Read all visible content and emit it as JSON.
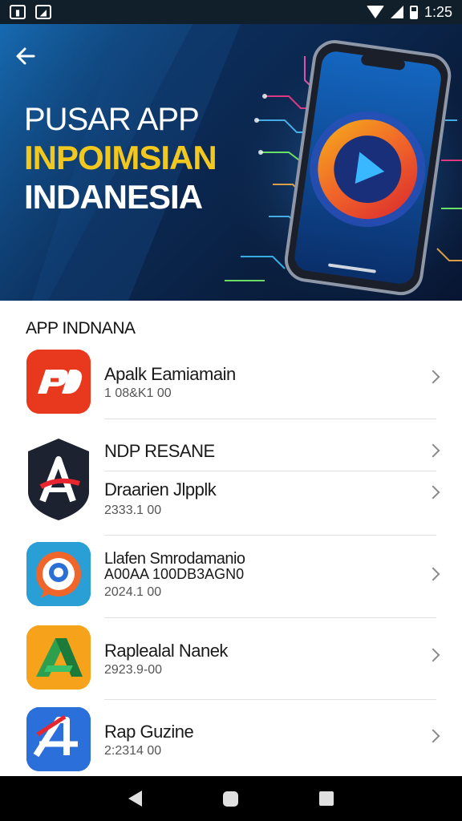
{
  "status_bar": {
    "time": "1:25"
  },
  "hero": {
    "title_line1": "PUSAR APP",
    "title_line2": "INPOIMSIAN",
    "title_line3": "INDANESIA"
  },
  "section": {
    "title": "APP INDNANA"
  },
  "apps": [
    {
      "name": "Apalk Eamiamain",
      "sub": "1 08&K1 00",
      "icon": "pd-logo-icon",
      "color": "#e8391f"
    },
    {
      "name": "NDP RESANE",
      "sub": "",
      "icon": "a-shield-logo-icon",
      "color": "#1c2230"
    },
    {
      "name": "Draarien Jlpplk",
      "sub": "2333.1 00",
      "icon": "",
      "color": ""
    },
    {
      "name": "Llafen Smrodamanio",
      "name2": "A00AA 100DB3AGN0",
      "sub": "2024.1 00",
      "icon": "p-chat-logo-icon",
      "color": "#2a9fd6"
    },
    {
      "name": "Raplealal Nanek",
      "sub": "2923.9-00",
      "icon": "a-triangle-logo-icon",
      "color": "#f7a21b"
    },
    {
      "name": "Rap Guzine",
      "sub": "2:2314 00",
      "icon": "a-slash-logo-icon",
      "color": "#2b6fdb"
    }
  ]
}
